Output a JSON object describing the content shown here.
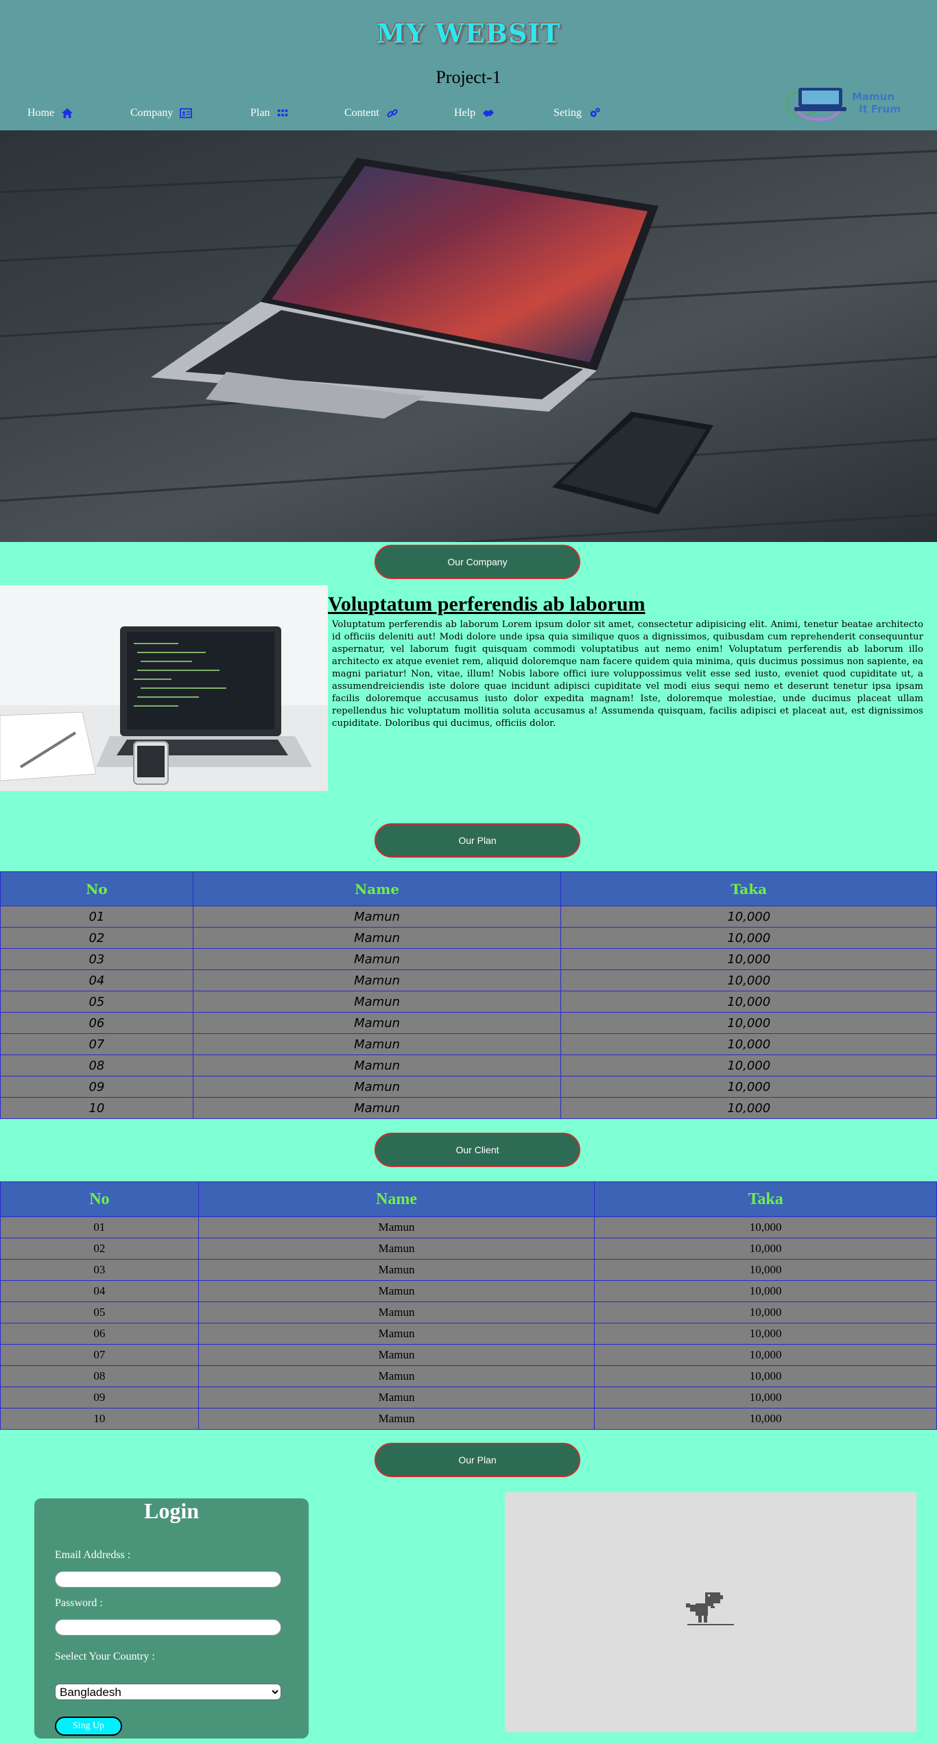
{
  "header": {
    "title": "MY WEBSIT",
    "subtitle": "Project-1",
    "nav": [
      {
        "label": "Home",
        "icon": "home-icon"
      },
      {
        "label": "Company",
        "icon": "id-card-icon"
      },
      {
        "label": "Plan",
        "icon": "grid-icon"
      },
      {
        "label": "Content",
        "icon": "link-icon"
      },
      {
        "label": "Help",
        "icon": "handshake-icon"
      },
      {
        "label": "Seting",
        "icon": "gears-icon"
      }
    ],
    "logo": {
      "text_line1": "Mamun",
      "text_line2": "It Frum"
    }
  },
  "hero": {
    "image": "laptop-and-phone-on-wooden-floor"
  },
  "sections": {
    "company_button": "Our Company",
    "plan_button": "Our Plan",
    "client_button": "Our Client",
    "plan_button_2": "Our Plan"
  },
  "company": {
    "image": "laptop-with-code-notebook-phone",
    "title": "Voluptatum perferendis ab laborum",
    "text": "Voluptatum perferendis ab laborum Lorem ipsum dolor sit amet, consectetur adipisicing elit. Animi, tenetur beatae architecto id officiis deleniti aut! Modi dolore unde ipsa quia similique quos a dignissimos, quibusdam cum reprehenderit consequuntur aspernatur, vel laborum fugit quisquam commodi voluptatibus aut nemo enim! Voluptatum perferendis ab laborum illo architecto ex atque eveniet rem, aliquid doloremque nam facere quidem quia minima, quis ducimus possimus non sapiente, ea magni pariatur! Non, vitae, illum! Nobis labore offici iure voluppossimus velit esse sed iusto, eveniet quod cupiditate ut, a assumendreiciendis iste dolore quae incidunt adipisci cupiditate vel modi eius sequi nemo et deserunt tenetur ipsa ipsam facilis doloremque accusamus iusto dolor expedita magnam! Iste, doloremque molestiae, unde ducimus placeat ullam repellendus hic voluptatum mollitia soluta accusamus a! Assumenda quisquam, facilis adipisci et placeat aut, est dignissimos cupiditate. Doloribus qui ducimus, officiis dolor."
  },
  "plan_table": {
    "headers": [
      "No",
      "Name",
      "Taka"
    ],
    "rows": [
      [
        "01",
        "Mamun",
        "10,000"
      ],
      [
        "02",
        "Mamun",
        "10,000"
      ],
      [
        "03",
        "Mamun",
        "10,000"
      ],
      [
        "04",
        "Mamun",
        "10,000"
      ],
      [
        "05",
        "Mamun",
        "10,000"
      ],
      [
        "06",
        "Mamun",
        "10,000"
      ],
      [
        "07",
        "Mamun",
        "10,000"
      ],
      [
        "08",
        "Mamun",
        "10,000"
      ],
      [
        "09",
        "Mamun",
        "10,000"
      ],
      [
        "10",
        "Mamun",
        "10,000"
      ]
    ]
  },
  "client_table": {
    "headers": [
      "No",
      "Name",
      "Taka"
    ],
    "rows": [
      [
        "01",
        "Mamun",
        "10,000"
      ],
      [
        "02",
        "Mamun",
        "10,000"
      ],
      [
        "03",
        "Mamun",
        "10,000"
      ],
      [
        "04",
        "Mamun",
        "10,000"
      ],
      [
        "05",
        "Mamun",
        "10,000"
      ],
      [
        "06",
        "Mamun",
        "10,000"
      ],
      [
        "07",
        "Mamun",
        "10,000"
      ],
      [
        "08",
        "Mamun",
        "10,000"
      ],
      [
        "09",
        "Mamun",
        "10,000"
      ],
      [
        "10",
        "Mamun",
        "10,000"
      ]
    ]
  },
  "login": {
    "title": "Login",
    "email_label": "Email Addredss :",
    "password_label": "Password :",
    "email_value": "",
    "password_value": "",
    "country_label": "Seelect Your Country :",
    "country_selected": "Bangladesh",
    "signup_button": "Sing Up"
  },
  "embed": {
    "state": "offline-dinosaur"
  },
  "colors": {
    "page_bg": "#7fffd4",
    "header_bg": "#5f9ea0",
    "title_color": "#2ee6ee",
    "pill_bg": "#2e6b54",
    "pill_border": "#d2282d",
    "table_header_bg": "#3c63b5",
    "table_header_text": "#6ff04a",
    "table_cell_bg": "#808080",
    "table_border": "#2a2ad0",
    "login_bg": "#4a957a",
    "signup_bg": "#00f0ff"
  }
}
